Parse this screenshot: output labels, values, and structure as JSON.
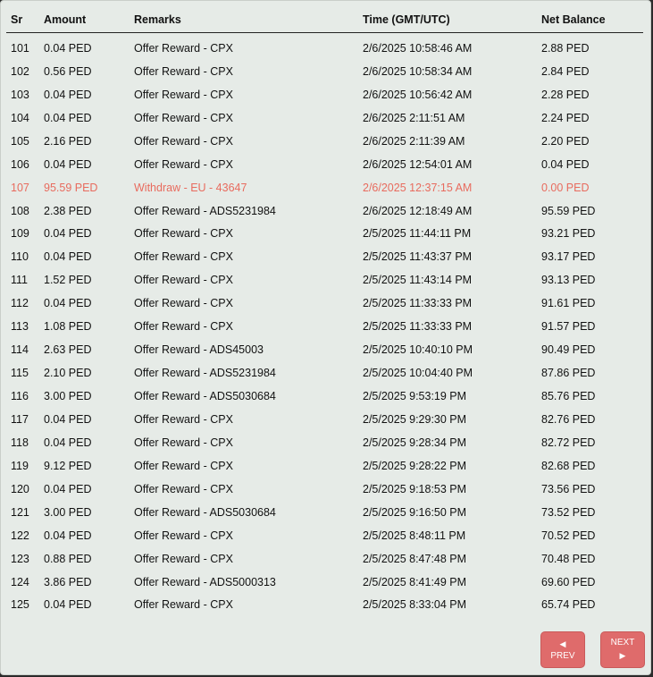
{
  "table": {
    "headers": [
      "Sr",
      "Amount",
      "Remarks",
      "Time (GMT/UTC)",
      "Net Balance"
    ],
    "rows": [
      {
        "sr": "101",
        "amount": "0.04 PED",
        "remarks": "Offer Reward - CPX",
        "time": "2/6/2025 10:58:46 AM",
        "balance": "2.88 PED"
      },
      {
        "sr": "102",
        "amount": "0.56 PED",
        "remarks": "Offer Reward - CPX",
        "time": "2/6/2025 10:58:34 AM",
        "balance": "2.84 PED"
      },
      {
        "sr": "103",
        "amount": "0.04 PED",
        "remarks": "Offer Reward - CPX",
        "time": "2/6/2025 10:56:42 AM",
        "balance": "2.28 PED"
      },
      {
        "sr": "104",
        "amount": "0.04 PED",
        "remarks": "Offer Reward - CPX",
        "time": "2/6/2025 2:11:51 AM",
        "balance": "2.24 PED"
      },
      {
        "sr": "105",
        "amount": "2.16 PED",
        "remarks": "Offer Reward - CPX",
        "time": "2/6/2025 2:11:39 AM",
        "balance": "2.20 PED"
      },
      {
        "sr": "106",
        "amount": "0.04 PED",
        "remarks": "Offer Reward - CPX",
        "time": "2/6/2025 12:54:01 AM",
        "balance": "0.04 PED"
      },
      {
        "sr": "107",
        "amount": "95.59 PED",
        "remarks": "Withdraw - EU - 43647",
        "time": "2/6/2025 12:37:15 AM",
        "balance": "0.00 PED",
        "highlight": true
      },
      {
        "sr": "108",
        "amount": "2.38 PED",
        "remarks": "Offer Reward - ADS5231984",
        "time": "2/6/2025 12:18:49 AM",
        "balance": "95.59 PED"
      },
      {
        "sr": "109",
        "amount": "0.04 PED",
        "remarks": "Offer Reward - CPX",
        "time": "2/5/2025 11:44:11 PM",
        "balance": "93.21 PED"
      },
      {
        "sr": "110",
        "amount": "0.04 PED",
        "remarks": "Offer Reward - CPX",
        "time": "2/5/2025 11:43:37 PM",
        "balance": "93.17 PED"
      },
      {
        "sr": "111",
        "amount": "1.52 PED",
        "remarks": "Offer Reward - CPX",
        "time": "2/5/2025 11:43:14 PM",
        "balance": "93.13 PED"
      },
      {
        "sr": "112",
        "amount": "0.04 PED",
        "remarks": "Offer Reward - CPX",
        "time": "2/5/2025 11:33:33 PM",
        "balance": "91.61 PED"
      },
      {
        "sr": "113",
        "amount": "1.08 PED",
        "remarks": "Offer Reward - CPX",
        "time": "2/5/2025 11:33:33 PM",
        "balance": "91.57 PED"
      },
      {
        "sr": "114",
        "amount": "2.63 PED",
        "remarks": "Offer Reward - ADS45003",
        "time": "2/5/2025 10:40:10 PM",
        "balance": "90.49 PED"
      },
      {
        "sr": "115",
        "amount": "2.10 PED",
        "remarks": "Offer Reward - ADS5231984",
        "time": "2/5/2025 10:04:40 PM",
        "balance": "87.86 PED"
      },
      {
        "sr": "116",
        "amount": "3.00 PED",
        "remarks": "Offer Reward - ADS5030684",
        "time": "2/5/2025 9:53:19 PM",
        "balance": "85.76 PED"
      },
      {
        "sr": "117",
        "amount": "0.04 PED",
        "remarks": "Offer Reward - CPX",
        "time": "2/5/2025 9:29:30 PM",
        "balance": "82.76 PED"
      },
      {
        "sr": "118",
        "amount": "0.04 PED",
        "remarks": "Offer Reward - CPX",
        "time": "2/5/2025 9:28:34 PM",
        "balance": "82.72 PED"
      },
      {
        "sr": "119",
        "amount": "9.12 PED",
        "remarks": "Offer Reward - CPX",
        "time": "2/5/2025 9:28:22 PM",
        "balance": "82.68 PED"
      },
      {
        "sr": "120",
        "amount": "0.04 PED",
        "remarks": "Offer Reward - CPX",
        "time": "2/5/2025 9:18:53 PM",
        "balance": "73.56 PED"
      },
      {
        "sr": "121",
        "amount": "3.00 PED",
        "remarks": "Offer Reward - ADS5030684",
        "time": "2/5/2025 9:16:50 PM",
        "balance": "73.52 PED"
      },
      {
        "sr": "122",
        "amount": "0.04 PED",
        "remarks": "Offer Reward - CPX",
        "time": "2/5/2025 8:48:11 PM",
        "balance": "70.52 PED"
      },
      {
        "sr": "123",
        "amount": "0.88 PED",
        "remarks": "Offer Reward - CPX",
        "time": "2/5/2025 8:47:48 PM",
        "balance": "70.48 PED"
      },
      {
        "sr": "124",
        "amount": "3.86 PED",
        "remarks": "Offer Reward - ADS5000313",
        "time": "2/5/2025 8:41:49 PM",
        "balance": "69.60 PED"
      },
      {
        "sr": "125",
        "amount": "0.04 PED",
        "remarks": "Offer Reward - CPX",
        "time": "2/5/2025 8:33:04 PM",
        "balance": "65.74 PED"
      }
    ]
  },
  "pagination": {
    "prev_label": "PREV",
    "next_label": "NEXT",
    "prev_icon": "left-triangle-icon",
    "next_icon": "right-triangle-icon"
  },
  "colors": {
    "panel_bg": "#e6ebe7",
    "withdraw_text": "#e86b5e",
    "button_bg": "#df6b6b"
  }
}
